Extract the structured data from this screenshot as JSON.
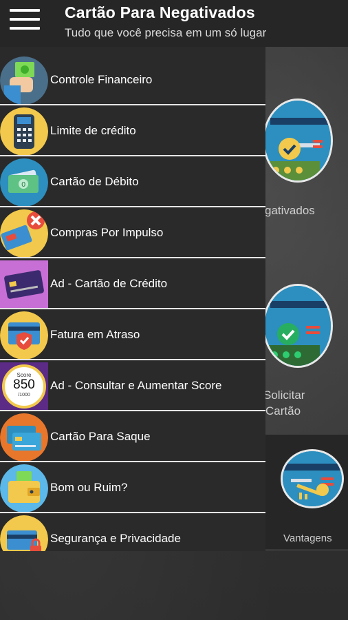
{
  "appbar": {
    "title": "Cartão Para Negativados",
    "subtitle": "Tudo que você precisa em um só lugar"
  },
  "background_cards": {
    "card1_label": "gativados",
    "card2_label_line1": "Solicitar",
    "card2_label_line2": "Cartão",
    "card3_label": "Vantagens"
  },
  "drawer": {
    "items": [
      {
        "label": "Controle Financeiro",
        "icon": "money-hand-icon"
      },
      {
        "label": "Limite de crédito",
        "icon": "card-terminal-icon"
      },
      {
        "label": "Cartão de Débito",
        "icon": "cash-icon"
      },
      {
        "label": "Compras Por Impulso",
        "icon": "card-cancel-icon"
      },
      {
        "label": "Ad - Cartão de Crédito",
        "icon": "credit-card-ad-icon"
      },
      {
        "label": "Fatura em Atraso",
        "icon": "shield-bill-icon"
      },
      {
        "label": "Ad - Consultar e Aumentar Score",
        "icon": "score-gauge-icon"
      },
      {
        "label": "Cartão Para Saque",
        "icon": "cards-icon"
      },
      {
        "label": "Bom ou Ruim?",
        "icon": "wallet-icon"
      },
      {
        "label": "Segurança e Privacidade",
        "icon": "card-lock-icon"
      }
    ],
    "score_icon_text": {
      "top": "Score",
      "value": "850",
      "bottom": "/1000"
    }
  },
  "colors": {
    "appbar": "#262626",
    "drawer": "#2a2a2a",
    "separator": "#e6e6e6",
    "icon_blue": "#2c8fbf",
    "icon_yellow": "#f2c94c",
    "icon_orange": "#e8762b",
    "icon_purple": "#9b59b6"
  }
}
